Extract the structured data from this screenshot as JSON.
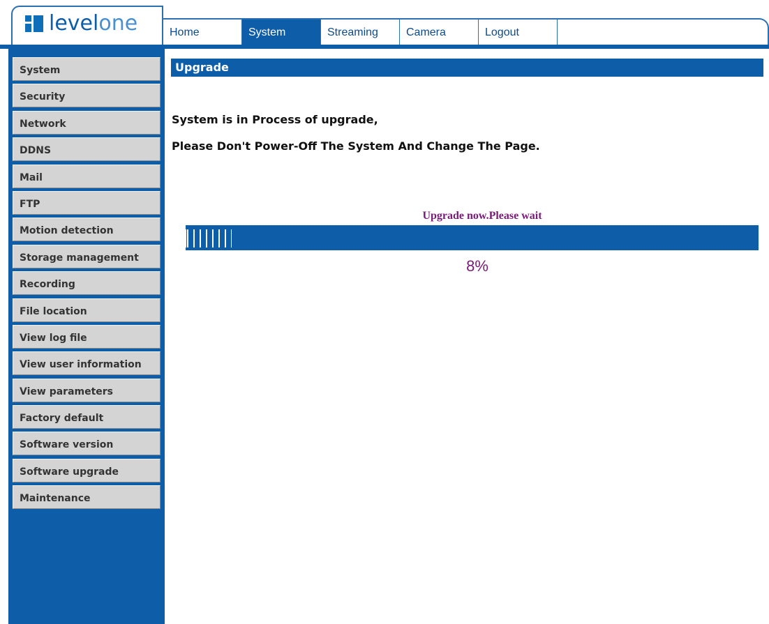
{
  "brand": {
    "logo_bold": "level",
    "logo_light": "one"
  },
  "nav": {
    "tabs": [
      {
        "label": "Home",
        "active": false
      },
      {
        "label": "System",
        "active": true
      },
      {
        "label": "Streaming",
        "active": false
      },
      {
        "label": "Camera",
        "active": false
      },
      {
        "label": "Logout",
        "active": false
      }
    ]
  },
  "sidebar": {
    "items": [
      {
        "label": "System"
      },
      {
        "label": "Security"
      },
      {
        "label": "Network"
      },
      {
        "label": "DDNS"
      },
      {
        "label": "Mail"
      },
      {
        "label": "FTP"
      },
      {
        "label": "Motion detection"
      },
      {
        "label": "Storage management"
      },
      {
        "label": "Recording"
      },
      {
        "label": "File location"
      },
      {
        "label": "View log file"
      },
      {
        "label": "View user information"
      },
      {
        "label": "View parameters"
      },
      {
        "label": "Factory default"
      },
      {
        "label": "Software version"
      },
      {
        "label": "Software upgrade"
      },
      {
        "label": "Maintenance"
      }
    ]
  },
  "main": {
    "section_title": "Upgrade",
    "message_line1": "System is in Process of upgrade,",
    "message_line2": "Please Don't Power-Off The System And Change The Page.",
    "progress": {
      "status_text": "Upgrade now.Please wait",
      "percent_label": "8%",
      "fraction": 0.08
    }
  },
  "colors": {
    "primary_blue": "#0e5da8",
    "sidebar_item_gray": "#d4d4d4",
    "progress_text_purple": "#7a1a78"
  }
}
